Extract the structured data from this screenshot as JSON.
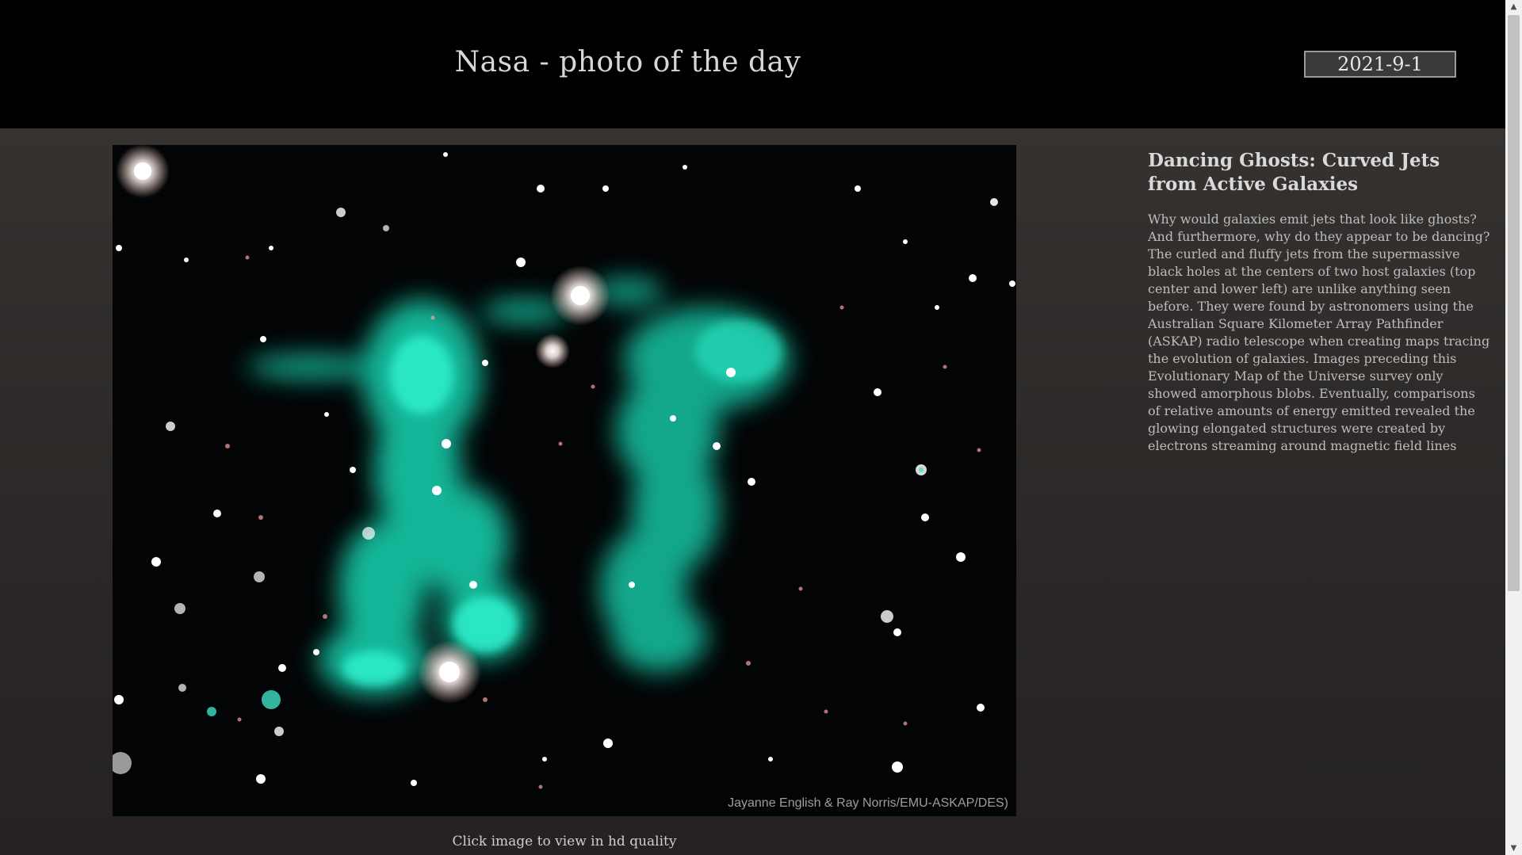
{
  "header": {
    "title": "Nasa - photo of the day",
    "date_value": "2021-9-1"
  },
  "photo": {
    "credit": "Jayanne English & Ray Norris/EMU-ASKAP/DES)",
    "hint": "Click image to view in hd quality"
  },
  "article": {
    "title": "Dancing Ghosts: Curved Jets from Active Galaxies",
    "body": "Why would galaxies emit jets that look like ghosts? And furthermore, why do they appear to be dancing? The curled and fluffy jets from the supermassive black holes at the centers of two host galaxies (top center and lower left) are unlike anything seen before. They were found by astronomers using the Australian Square Kilometer Array Pathfinder (ASKAP) radio telescope when creating maps tracing the evolution of galaxies. Images preceding this Evolutionary Map of the Universe survey only showed amorphous blobs. Eventually, comparisons of relative amounts of energy emitted revealed the glowing elongated structures were created by electrons streaming around magnetic field lines"
  },
  "scrollbar": {
    "up_icon": "triangle-up-icon",
    "down_icon": "triangle-down-icon"
  },
  "colors": {
    "header_bg": "#000000",
    "page_bg": "#2b2827",
    "jet_color": "#1fd6b6"
  }
}
